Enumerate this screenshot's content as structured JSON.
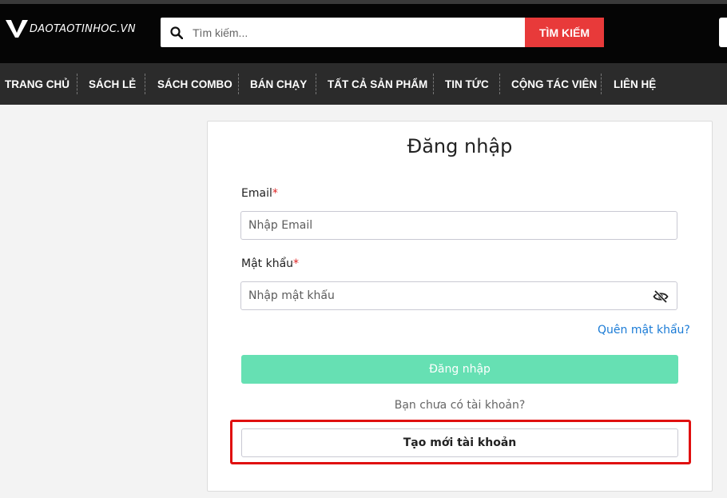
{
  "header": {
    "logo_text": "DAOTAOTINHOC.VN",
    "search": {
      "placeholder": "Tìm kiếm...",
      "value": ""
    },
    "search_button": "TÌM KIẾM"
  },
  "nav": {
    "items": [
      "TRANG CHỦ",
      "SÁCH LẺ",
      "SÁCH COMBO",
      "BÁN CHẠY",
      "TẤT CẢ SẢN PHẨM",
      "TIN TỨC",
      "CỘNG TÁC VIÊN",
      "LIÊN HỆ"
    ]
  },
  "login": {
    "title": "Đăng nhập",
    "email_label": "Email",
    "email_placeholder": "Nhập Email",
    "password_label": "Mật khẩu",
    "password_placeholder": "Nhập mật khẩu",
    "required_mark": "*",
    "forgot_link": "Quên mật khẩu?",
    "submit_button": "Đăng nhập",
    "no_account_text": "Bạn chưa có tài khoản?",
    "create_account_button": "Tạo mới tài khoản"
  },
  "colors": {
    "accent_red": "#e83a3a",
    "login_button": "#66e0b3",
    "link": "#1a7bd6",
    "highlight_border": "#e01010"
  }
}
